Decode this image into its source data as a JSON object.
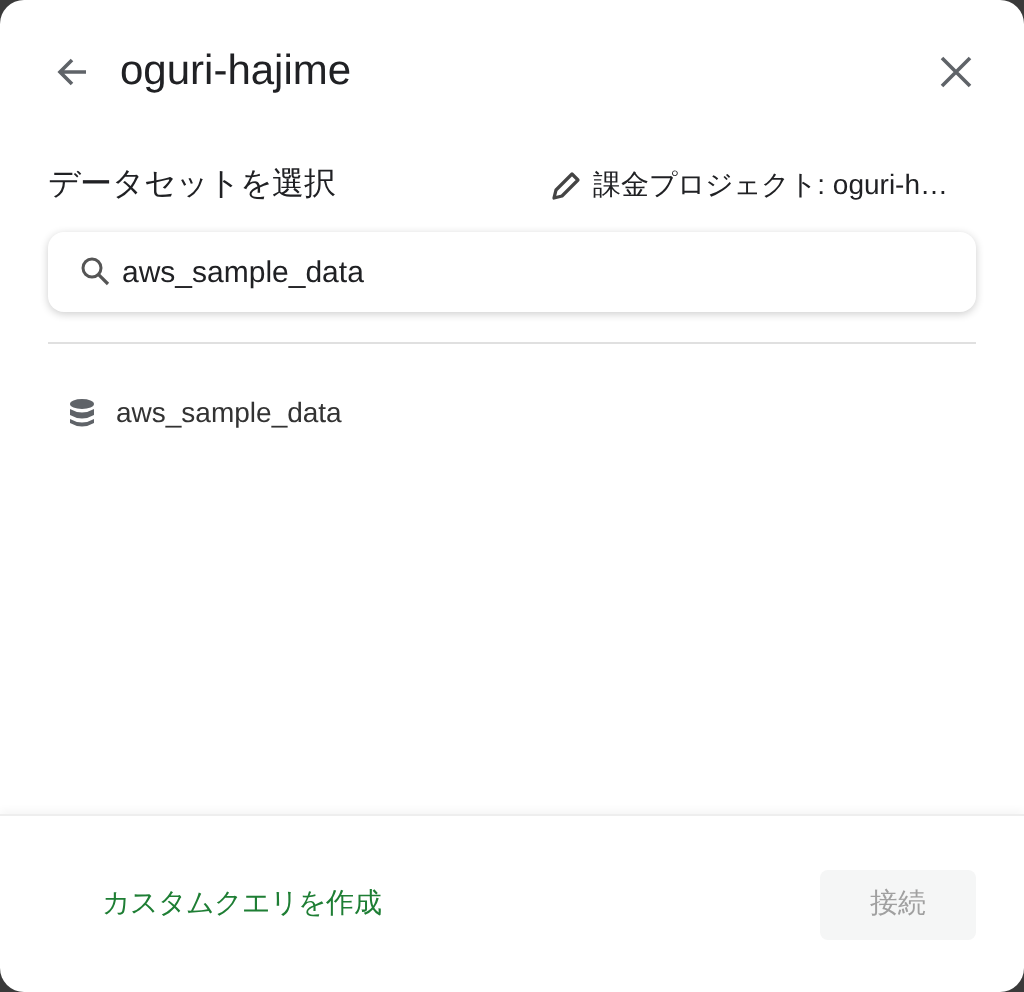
{
  "dialog": {
    "title": "oguri-hajime"
  },
  "section": {
    "label": "データセットを選択",
    "billing_project": "課金プロジェクト: oguri-h…"
  },
  "search": {
    "value": "aws_sample_data"
  },
  "datasets": [
    {
      "name": "aws_sample_data"
    }
  ],
  "footer": {
    "custom_query": "カスタムクエリを作成",
    "connect": {
      "label": "接続",
      "disabled": true
    }
  }
}
